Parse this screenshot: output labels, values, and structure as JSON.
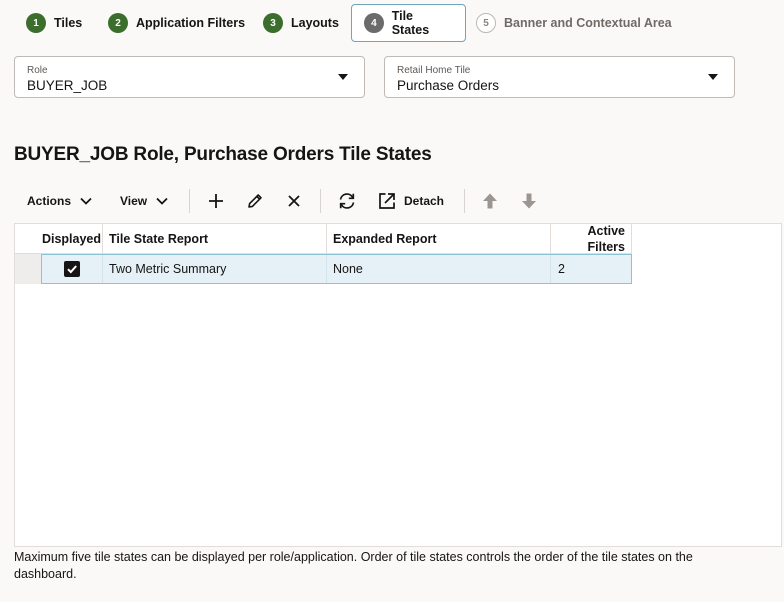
{
  "train": {
    "steps": [
      {
        "number": "1",
        "label": "Tiles"
      },
      {
        "number": "2",
        "label": "Application Filters"
      },
      {
        "number": "3",
        "label": "Layouts"
      },
      {
        "number": "4",
        "label": "Tile States"
      },
      {
        "number": "5",
        "label": "Banner and Contextual Area"
      }
    ],
    "current_step": "4"
  },
  "filters": {
    "role": {
      "label": "Role",
      "value": "BUYER_JOB"
    },
    "tile": {
      "label": "Retail Home Tile",
      "value": "Purchase Orders"
    }
  },
  "page": {
    "title": "BUYER_JOB Role, Purchase Orders Tile States"
  },
  "toolbar": {
    "actions_label": "Actions",
    "view_label": "View",
    "detach_label": "Detach",
    "icons": [
      "add-icon",
      "edit-icon",
      "delete-icon",
      "refresh-icon",
      "detach-icon",
      "move-up-icon",
      "move-down-icon"
    ]
  },
  "table": {
    "columns": [
      "Displayed",
      "Tile State Report",
      "Expanded Report",
      "Active Filters"
    ],
    "rows": [
      {
        "displayed": true,
        "tile_state_report": "Two Metric Summary",
        "expanded_report": "None",
        "active_filters": "2"
      }
    ]
  },
  "footnote": "Maximum five tile states can be displayed per role/application. Order of tile states controls the order of the tile states on the dashboard.",
  "colors": {
    "step_complete": "#3b6e2c",
    "step_current": "#6b6b6b",
    "row_selected_bg": "#e5f1f6",
    "row_selected_border": "#8ec3d6"
  }
}
